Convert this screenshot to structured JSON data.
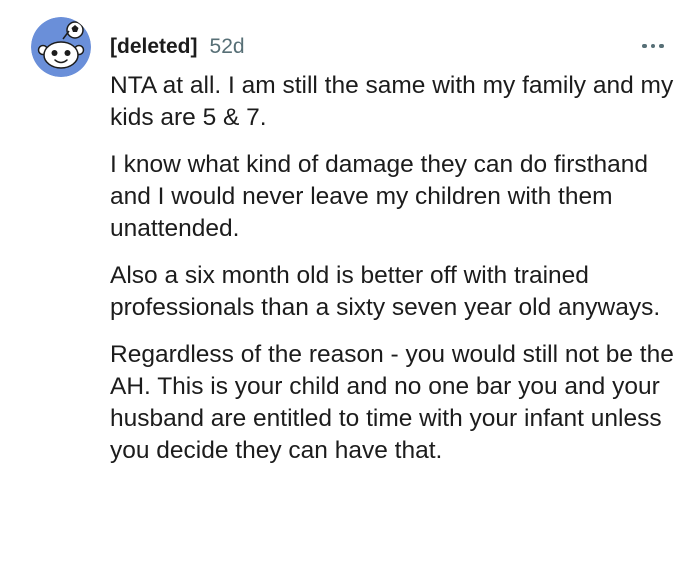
{
  "comment": {
    "author": "[deleted]",
    "age": "52d",
    "paragraphs": [
      "NTA at all. I am still the same with my family and my kids are 5 & 7.",
      "I know what kind of damage they can do firsthand and I would never leave my children with them unattended.",
      "Also a six month old is better off with trained professionals than a sixty seven year old anyways.",
      "Regardless of the reason - you would still not be the AH. This is your child and no one bar you and your husband are entitled to time with your infant unless you decide they can have that."
    ]
  },
  "icons": {
    "avatar": "default-snoo-avatar-icon",
    "more": "more-options-icon"
  },
  "colors": {
    "avatar_background": "#6a8fd9",
    "meta_text": "#576f76",
    "body_text": "#1c1c1c"
  }
}
